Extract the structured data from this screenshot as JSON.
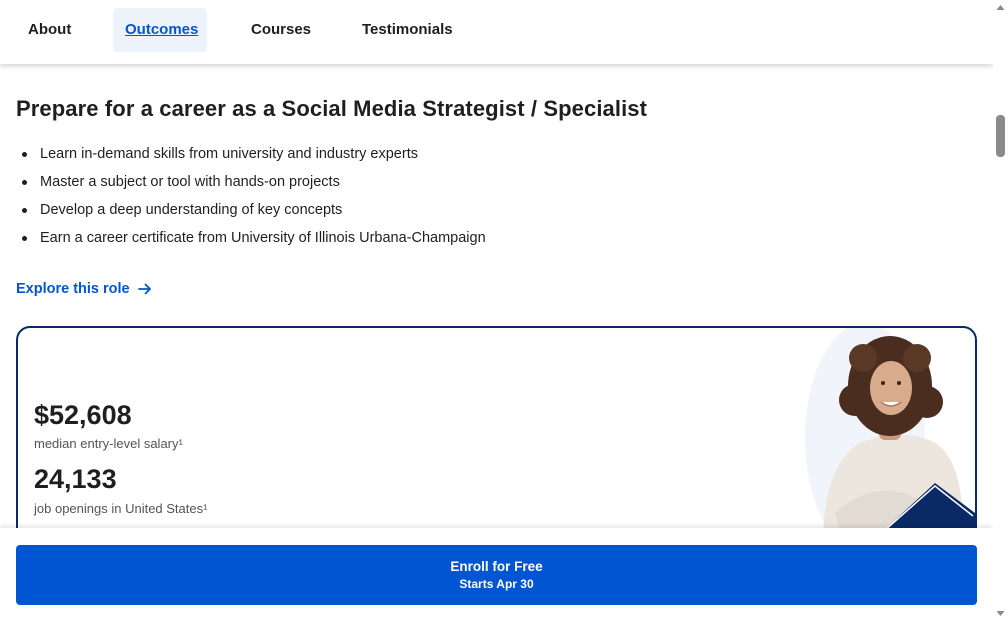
{
  "nav": {
    "items": [
      {
        "label": "About"
      },
      {
        "label": "Outcomes",
        "active": true
      },
      {
        "label": "Courses"
      },
      {
        "label": "Testimonials"
      }
    ]
  },
  "main": {
    "heading": "Prepare for a career as a Social Media Strategist / Specialist",
    "bullets": [
      "Learn in-demand skills from university and industry experts",
      "Master a subject or tool with hands-on projects",
      "Develop a deep understanding of key concepts",
      "Earn a career certificate from University of Illinois Urbana-Champaign"
    ],
    "explore_link": "Explore this role",
    "explore_icon": "arrow-right-icon"
  },
  "card": {
    "salary_value": "$52,608",
    "salary_label": "median entry-level salary¹",
    "openings_value": "24,133",
    "openings_label": "job openings in United States¹",
    "image_alt": "smiling woman with crossed arms"
  },
  "enroll": {
    "title": "Enroll for Free",
    "subtitle": "Starts Apr 30"
  },
  "colors": {
    "accent": "#0056d2",
    "card_border": "#0a2a66",
    "text": "#1f1f1f",
    "muted": "#545454"
  }
}
